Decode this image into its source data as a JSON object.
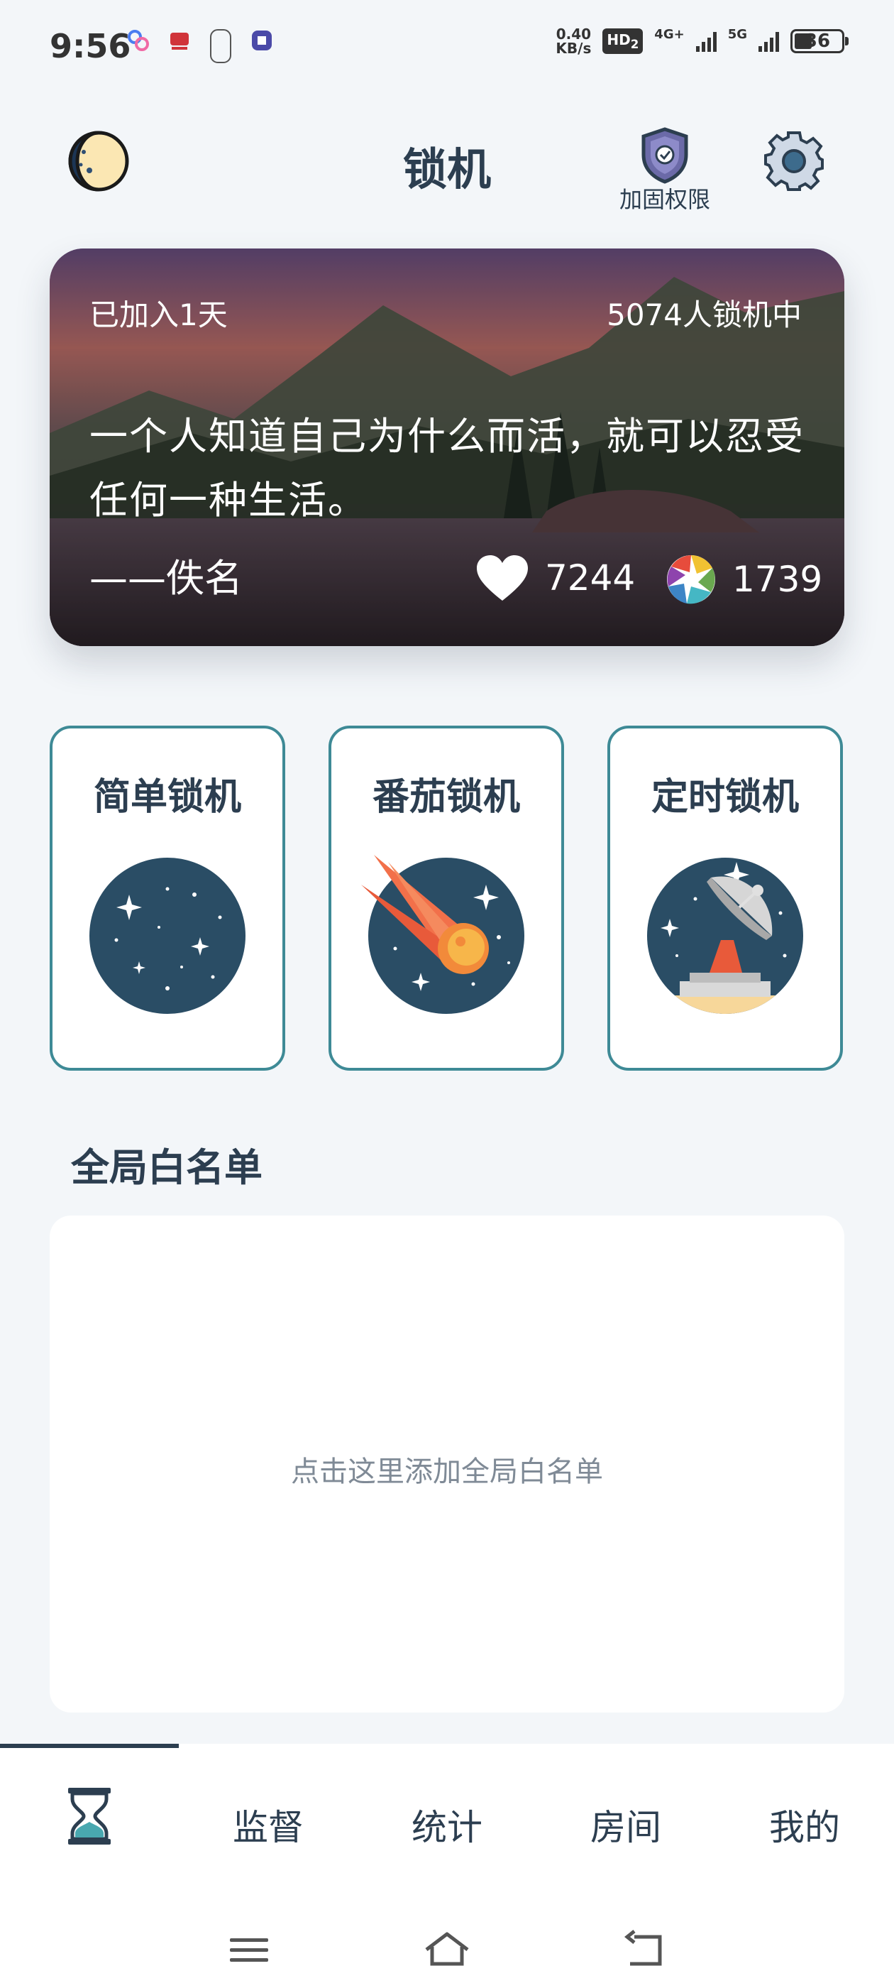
{
  "status_bar": {
    "time": "9:56",
    "net_speed_value": "0.40",
    "net_speed_unit": "KB/s",
    "hd_label": "HD",
    "hd_sub": "2",
    "network_1": "4G+",
    "network_2": "5G",
    "battery": "36"
  },
  "header": {
    "title": "锁机",
    "theme_toggle_icon": "moon-icon",
    "permission_icon": "shield-icon",
    "permission_label": "加固权限",
    "settings_icon": "gear-icon"
  },
  "quote_card": {
    "joined_text": "已加入1天",
    "locking_count_text": "5074人锁机中",
    "quote": "一个人知道自己为什么而活，就可以忍受任何一种生活。",
    "author": "——佚名",
    "likes": "7244",
    "shares": "1739"
  },
  "modes": [
    {
      "label": "简单锁机",
      "icon": "starry-planet-icon"
    },
    {
      "label": "番茄锁机",
      "icon": "meteor-icon"
    },
    {
      "label": "定时锁机",
      "icon": "satellite-dish-icon"
    }
  ],
  "whitelist": {
    "title": "全局白名单",
    "hint": "点击这里添加全局白名单"
  },
  "bottom_nav": {
    "active_icon": "hourglass-icon",
    "items": [
      "监督",
      "统计",
      "房间",
      "我的"
    ]
  },
  "system_nav": {
    "icons": [
      "menu-icon",
      "home-icon",
      "back-icon"
    ]
  },
  "colors": {
    "primary": "#2c3e50",
    "accent": "#3e8a96",
    "planet": "#2a4d65",
    "background": "#f3f6f9"
  }
}
